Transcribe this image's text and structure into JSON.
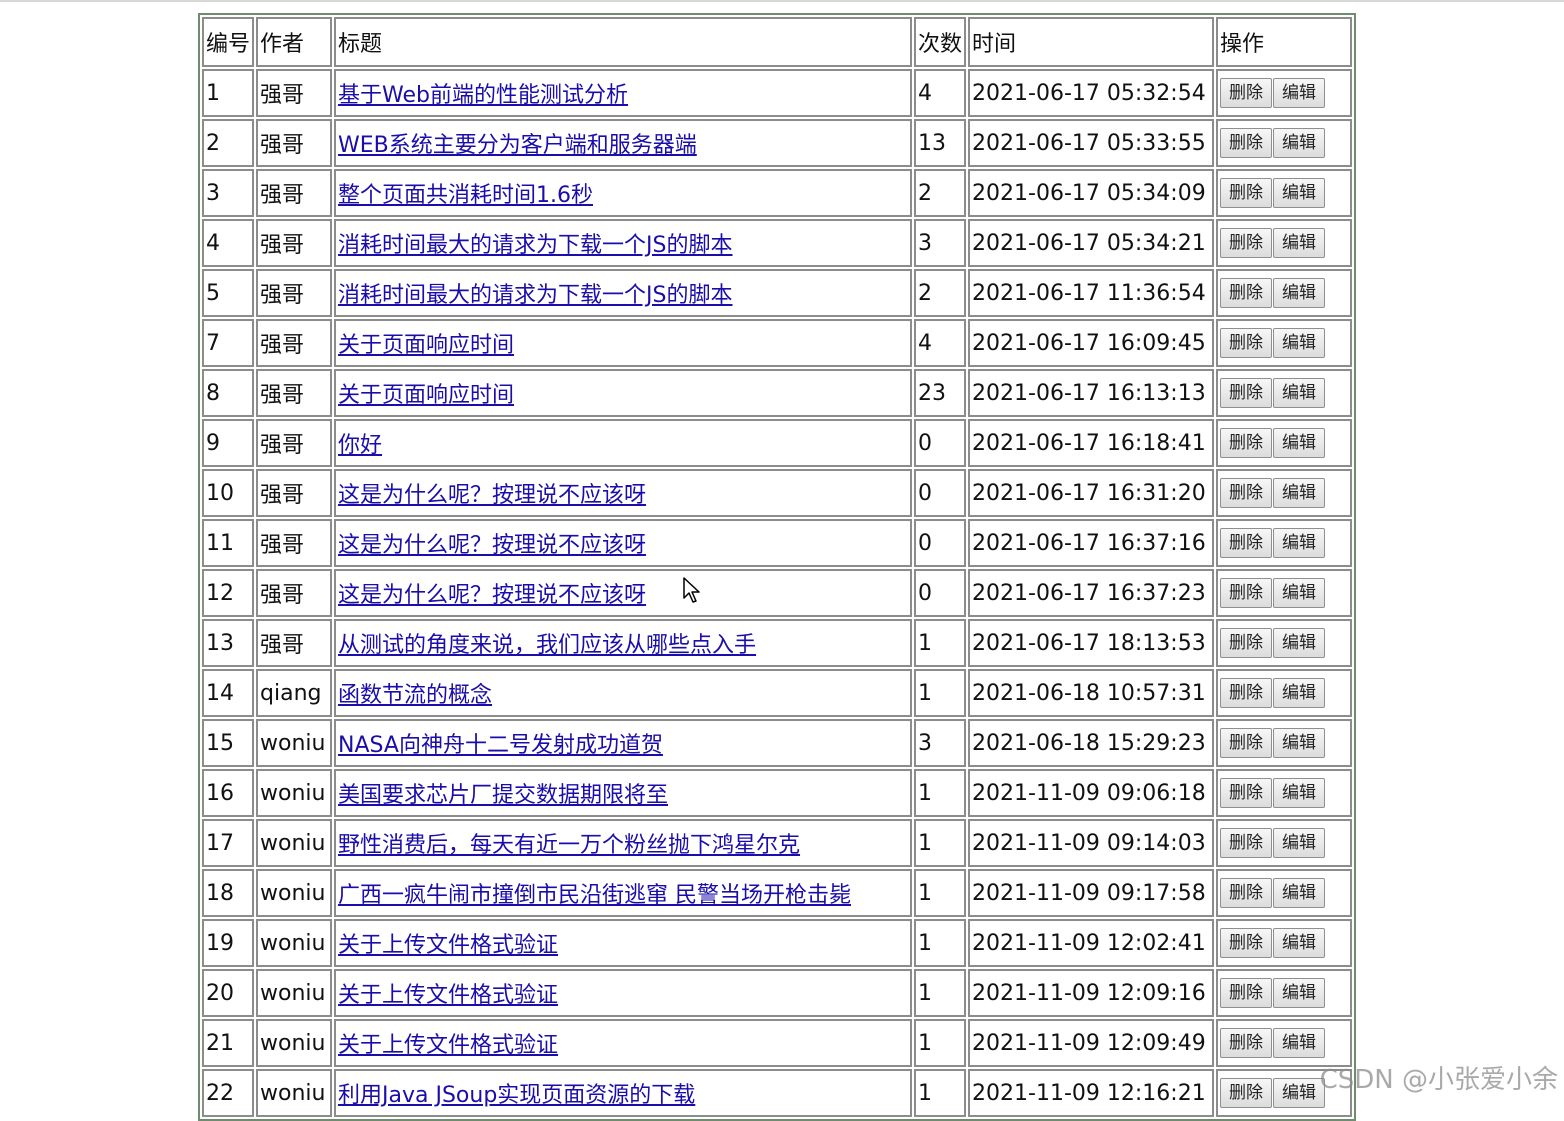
{
  "headers": [
    "编号",
    "作者",
    "标题",
    "次数",
    "时间",
    "操作"
  ],
  "buttons": {
    "delete": "删除",
    "edit": "编辑"
  },
  "rows": [
    {
      "id": "1",
      "author": "强哥",
      "title": "基于Web前端的性能测试分析",
      "count": "4",
      "time": "2021-06-17 05:32:54"
    },
    {
      "id": "2",
      "author": "强哥",
      "title": "WEB系统主要分为客户端和服务器端",
      "count": "13",
      "time": "2021-06-17 05:33:55"
    },
    {
      "id": "3",
      "author": "强哥",
      "title": "整个页面共消耗时间1.6秒",
      "count": "2",
      "time": "2021-06-17 05:34:09"
    },
    {
      "id": "4",
      "author": "强哥",
      "title": "消耗时间最大的请求为下载一个JS的脚本",
      "count": "3",
      "time": "2021-06-17 05:34:21"
    },
    {
      "id": "5",
      "author": "强哥",
      "title": "消耗时间最大的请求为下载一个JS的脚本",
      "count": "2",
      "time": "2021-06-17 11:36:54"
    },
    {
      "id": "7",
      "author": "强哥",
      "title": "关于页面响应时间",
      "count": "4",
      "time": "2021-06-17 16:09:45"
    },
    {
      "id": "8",
      "author": "强哥",
      "title": "关于页面响应时间",
      "count": "23",
      "time": "2021-06-17 16:13:13"
    },
    {
      "id": "9",
      "author": "强哥",
      "title": "你好",
      "count": "0",
      "time": "2021-06-17 16:18:41"
    },
    {
      "id": "10",
      "author": "强哥",
      "title": "这是为什么呢？按理说不应该呀",
      "count": "0",
      "time": "2021-06-17 16:31:20"
    },
    {
      "id": "11",
      "author": "强哥",
      "title": "这是为什么呢？按理说不应该呀",
      "count": "0",
      "time": "2021-06-17 16:37:16"
    },
    {
      "id": "12",
      "author": "强哥",
      "title": "这是为什么呢？按理说不应该呀",
      "count": "0",
      "time": "2021-06-17 16:37:23"
    },
    {
      "id": "13",
      "author": "强哥",
      "title": "从测试的角度来说，我们应该从哪些点入手",
      "count": "1",
      "time": "2021-06-17 18:13:53"
    },
    {
      "id": "14",
      "author": "qiang",
      "title": "函数节流的概念",
      "count": "1",
      "time": "2021-06-18 10:57:31"
    },
    {
      "id": "15",
      "author": "woniu",
      "title": "NASA向神舟十二号发射成功道贺",
      "count": "3",
      "time": "2021-06-18 15:29:23"
    },
    {
      "id": "16",
      "author": "woniu",
      "title": "美国要求芯片厂提交数据期限将至",
      "count": "1",
      "time": "2021-11-09 09:06:18"
    },
    {
      "id": "17",
      "author": "woniu",
      "title": "野性消费后，每天有近一万个粉丝抛下鸿星尔克",
      "count": "1",
      "time": "2021-11-09 09:14:03"
    },
    {
      "id": "18",
      "author": "woniu",
      "title": "广西一疯牛闹市撞倒市民沿街逃窜 民警当场开枪击毙",
      "count": "1",
      "time": "2021-11-09 09:17:58"
    },
    {
      "id": "19",
      "author": "woniu",
      "title": "关于上传文件格式验证",
      "count": "1",
      "time": "2021-11-09 12:02:41"
    },
    {
      "id": "20",
      "author": "woniu",
      "title": "关于上传文件格式验证",
      "count": "1",
      "time": "2021-11-09 12:09:16"
    },
    {
      "id": "21",
      "author": "woniu",
      "title": "关于上传文件格式验证",
      "count": "1",
      "time": "2021-11-09 12:09:49"
    },
    {
      "id": "22",
      "author": "woniu",
      "title": "利用Java JSoup实现页面资源的下载",
      "count": "1",
      "time": "2021-11-09 12:16:21"
    }
  ],
  "watermark": "CSDN @小张爱小余"
}
